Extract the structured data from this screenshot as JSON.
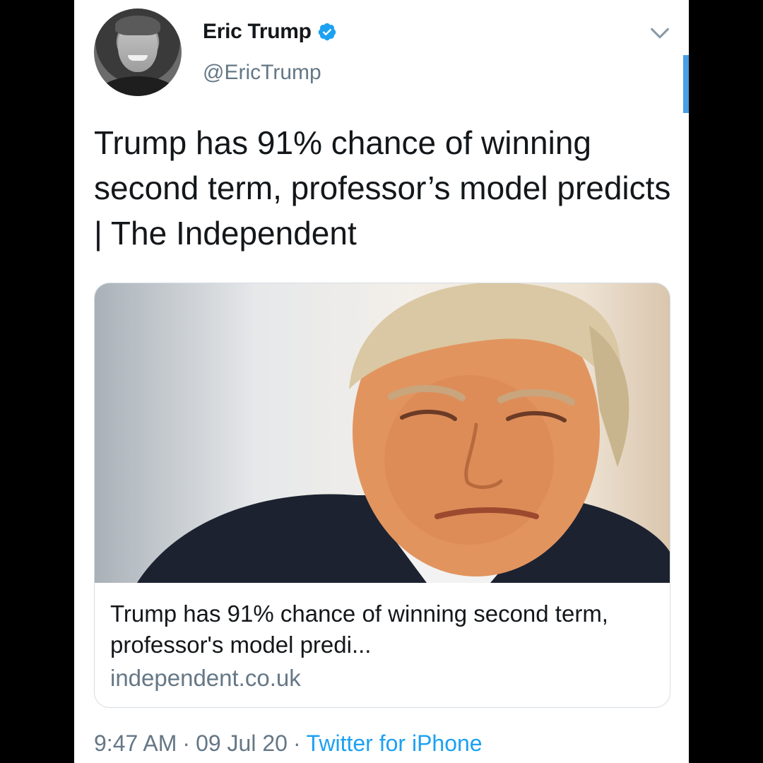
{
  "author": {
    "display_name": "Eric Trump",
    "handle": "@EricTrump",
    "verified": true,
    "avatar_icon": "profile-photo",
    "verified_icon": "verified-badge-icon"
  },
  "menu_icon": "chevron-down-icon",
  "tweet": {
    "text": "Trump has 91% chance of winning second term, professor’s model predicts | The Independent"
  },
  "card": {
    "image_icon": "article-photo",
    "title": "Trump has 91% chance of winning second term, professor's model predi...",
    "domain": "independent.co.uk"
  },
  "meta": {
    "time": "9:47 AM",
    "separator": "·",
    "date": "09 Jul 20",
    "source": "Twitter for iPhone"
  },
  "colors": {
    "background": "#000000",
    "surface": "#ffffff",
    "text_primary": "#14171a",
    "text_secondary": "#657786",
    "accent": "#1da1f2"
  }
}
